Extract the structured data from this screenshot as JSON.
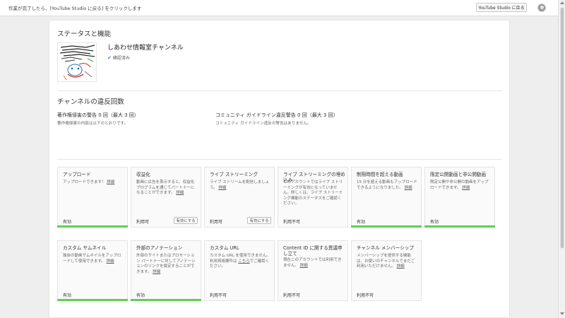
{
  "topbar": {
    "message": "作業が完了したら、[YouTube Studio に戻る] をクリックします",
    "back_button": "YouTube Studio に戻る"
  },
  "status": {
    "title": "ステータスと機能",
    "channel_name": "しあわせ情報室チャンネル",
    "verified": "確認済み"
  },
  "strikes": {
    "title": "チャンネルの違反回数",
    "copyright": {
      "heading": "著作権侵害の警告 0 回（最大 3 回）",
      "detail": "著作権侵害の内容は以下のとおりです。"
    },
    "community": {
      "heading": "コミュニティ ガイドライン違反警告 0 回（最大 3 回）",
      "detail": "コミュニティ ガイドライン違反の警告はありません。"
    }
  },
  "features": [
    {
      "title": "アップロード",
      "desc": "アップロードできます！",
      "link": "詳細",
      "state": "有効",
      "active": true
    },
    {
      "title": "収益化",
      "desc": "動画に広告を表示すると、収益化プログラムを通じてパートナーになることができます。",
      "link": "詳細",
      "state": "利用可",
      "button": "有効にする",
      "active": false
    },
    {
      "title": "ライブ ストリーミング",
      "desc": "ライブ ストリームを配信しましょう。",
      "link": "詳細",
      "state": "利用可",
      "button": "有効にする",
      "active": false
    },
    {
      "title": "ライブ ストリーミングの埋め込み",
      "desc": "このアカウントではライブ ストリーミングが有効になっていません。詳しくは、ライブ ストリーミング機能のステータスをご確認ください。",
      "link": "",
      "state": "利用不可",
      "active": false
    },
    {
      "title": "制限時間を超える動画",
      "desc": "15 分を超える動画もアップロードできるようになりました。",
      "link": "詳細",
      "state": "有効",
      "active": true
    },
    {
      "title": "限定公開動画と非公開動画",
      "desc": "限定公開や非公開の動画をアップロードできます。",
      "link": "詳細",
      "state": "有効",
      "active": true
    },
    {
      "title": "カスタム サムネイル",
      "desc": "独自の動画サムネイルをアップロードして使用できます。",
      "link": "詳細",
      "state": "有効",
      "active": true
    },
    {
      "title": "外部のアノテーション",
      "desc": "外部のサイトまたはプロモーション パートナーに対してアノテーションのリンクを設定することができます。",
      "link": "詳細",
      "state": "有効",
      "active": true
    },
    {
      "title": "カスタム URL",
      "desc": "カスタム URL を使用できません。利用資格要件は",
      "link": "こちら",
      "desc_after": "でご確認ください。",
      "state": "利用不可",
      "active": false
    },
    {
      "title": "Content ID に関する異議申し立て",
      "desc": "現在このアカウントでは利用できません。",
      "link": "詳細",
      "state": "利用不可",
      "active": false
    },
    {
      "title": "チャンネル メンバーシップ",
      "desc": "メンバーシップを提供する機能は、お使いのチャンネルでまだご利用いただけません。",
      "link": "詳細",
      "state": "利用不可",
      "active": false
    }
  ]
}
